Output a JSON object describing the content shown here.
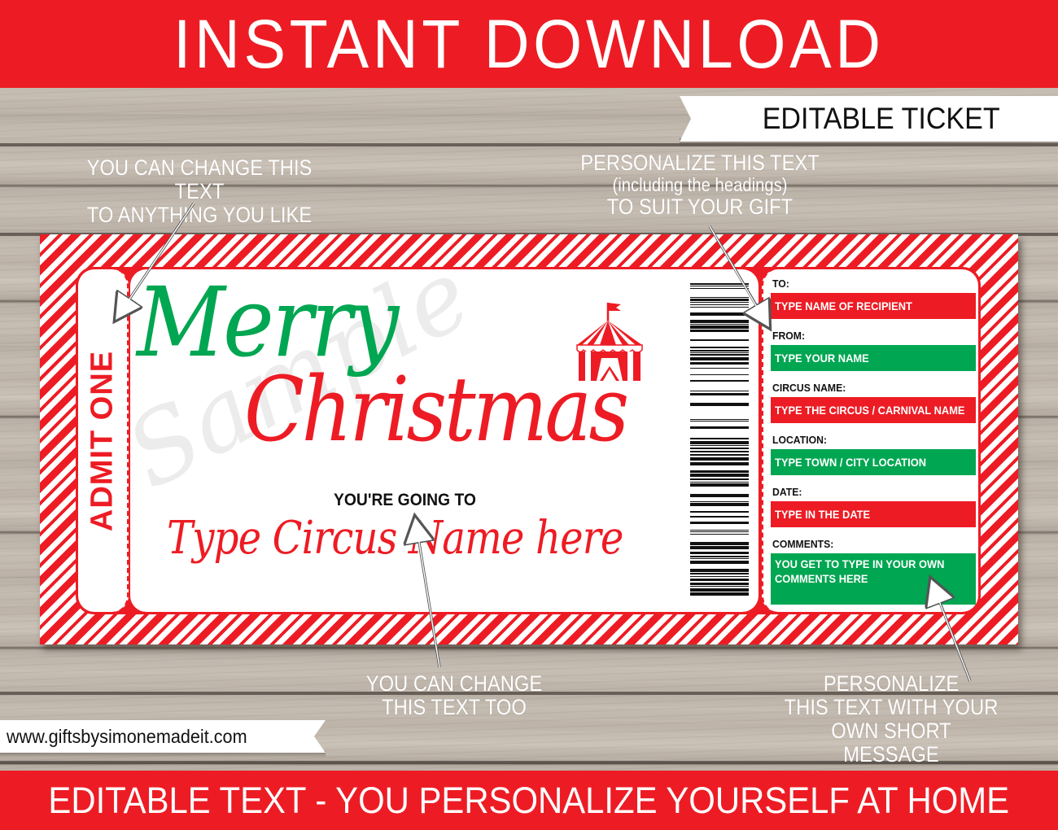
{
  "header": {
    "banner": "INSTANT DOWNLOAD",
    "ribbon": "EDITABLE TICKET"
  },
  "notes": {
    "top_left": [
      "YOU CAN CHANGE THIS TEXT",
      "TO ANYTHING YOU LIKE"
    ],
    "top_right": {
      "line1": "PERSONALIZE THIS TEXT",
      "line2": "(including the headings)",
      "line3": "TO SUIT YOUR GIFT"
    },
    "bottom_center": [
      "YOU CAN CHANGE",
      "THIS TEXT TOO"
    ],
    "bottom_right": [
      "PERSONALIZE",
      "THIS TEXT WITH YOUR",
      "OWN SHORT MESSAGE"
    ]
  },
  "ticket": {
    "stub": "ADMIT ONE",
    "greeting_line1": "Merry",
    "greeting_line2": "Christmas",
    "going_to": "YOU'RE GOING TO",
    "event_name": "Type Circus Name here",
    "watermark": "Sample",
    "icon": "circus-tent-icon",
    "fields": [
      {
        "label": "TO:",
        "value": "TYPE NAME OF RECIPIENT",
        "color": "#ed1c24"
      },
      {
        "label": "FROM:",
        "value": "TYPE YOUR NAME",
        "color": "#00a651"
      },
      {
        "label": "CIRCUS NAME:",
        "value": "TYPE THE CIRCUS / CARNIVAL NAME",
        "color": "#ed1c24"
      },
      {
        "label": "LOCATION:",
        "value": "TYPE TOWN / CITY LOCATION",
        "color": "#00a651"
      },
      {
        "label": "DATE:",
        "value": "TYPE IN THE DATE",
        "color": "#ed1c24"
      },
      {
        "label": "COMMENTS:",
        "value": "YOU GET TO TYPE IN YOUR OWN COMMENTS HERE",
        "color": "#00a651"
      }
    ]
  },
  "footer": {
    "website": "www.giftsbysimonemadeit.com",
    "banner": "EDITABLE TEXT - YOU PERSONALIZE YOURSELF AT HOME"
  },
  "colors": {
    "red": "#ed1c24",
    "green": "#00a651",
    "wood": "#bdb3a9"
  }
}
